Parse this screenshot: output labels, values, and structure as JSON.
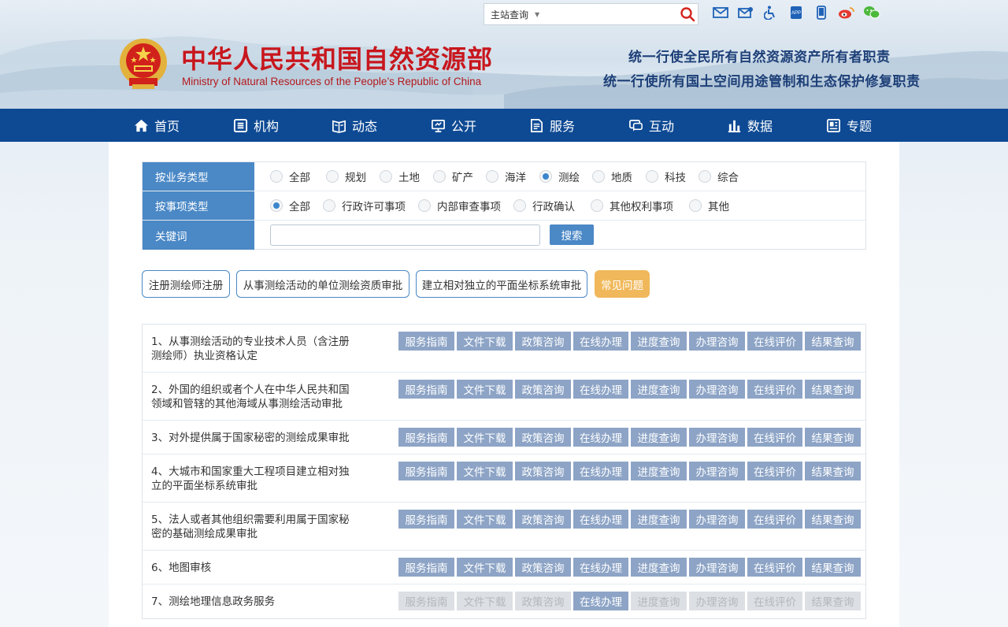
{
  "header": {
    "search_scope": "主站查询",
    "title_cn": "中华人民共和国自然资源部",
    "title_en": "Ministry of Natural Resources of the People’s Republic of China",
    "slogans": [
      "统一行使全民所有自然资源资产所有者职责",
      "统一行使所有国土空间用途管制和生态保护修复职责"
    ],
    "top_icons": [
      "mail-icon",
      "mailbox-icon",
      "accessibility-icon",
      "app-icon",
      "mobile-icon",
      "weibo-icon",
      "wechat-icon"
    ]
  },
  "nav": {
    "items": [
      {
        "label": "首页",
        "icon": "home-icon"
      },
      {
        "label": "机构",
        "icon": "org-icon"
      },
      {
        "label": "动态",
        "icon": "news-icon"
      },
      {
        "label": "公开",
        "icon": "open-icon"
      },
      {
        "label": "服务",
        "icon": "service-icon"
      },
      {
        "label": "互动",
        "icon": "interact-icon"
      },
      {
        "label": "数据",
        "icon": "chart-icon"
      },
      {
        "label": "专题",
        "icon": "topic-icon"
      }
    ]
  },
  "filters": {
    "business_type": {
      "label": "按业务类型",
      "options": [
        "全部",
        "规划",
        "土地",
        "矿产",
        "海洋",
        "测绘",
        "地质",
        "科技",
        "综合"
      ],
      "selected": "测绘"
    },
    "item_type": {
      "label": "按事项类型",
      "options": [
        "全部",
        "行政许可事项",
        "内部审查事项",
        "行政确认",
        "其他权利事项",
        "其他"
      ],
      "selected": "全部"
    },
    "keyword": {
      "label": "关键词",
      "value": "",
      "search_label": "搜索"
    }
  },
  "quick_tags": [
    "注册测绘师注册",
    "从事测绘活动的单位测绘资质审批",
    "建立相对独立的平面坐标系统审批",
    "常见问题"
  ],
  "action_labels": [
    "服务指南",
    "文件下载",
    "政策咨询",
    "在线办理",
    "进度查询",
    "办理咨询",
    "在线评价",
    "结果查询"
  ],
  "services": [
    {
      "name_line1": "1、从事测绘活动的专业技术人员（含注册",
      "name_line2": "测绘师）执业资格认定",
      "enabled": true
    },
    {
      "name_line1": "2、外国的组织或者个人在中华人民共和国",
      "name_line2": "领域和管辖的其他海域从事测绘活动审批",
      "enabled": true
    },
    {
      "name_line1": "3、对外提供属于国家秘密的测绘成果审批",
      "name_line2": "",
      "enabled": true
    },
    {
      "name_line1": "4、大城市和国家重大工程项目建立相对独",
      "name_line2": "立的平面坐标系统审批",
      "enabled": true
    },
    {
      "name_line1": "5、法人或者其他组织需要利用属于国家秘",
      "name_line2": "密的基础测绘成果审批",
      "enabled": true
    },
    {
      "name_line1": "6、地图审核",
      "name_line2": "",
      "enabled": true
    },
    {
      "name_line1": "7、测绘地理信息政务服务",
      "name_line2": "",
      "enabled": false
    }
  ]
}
